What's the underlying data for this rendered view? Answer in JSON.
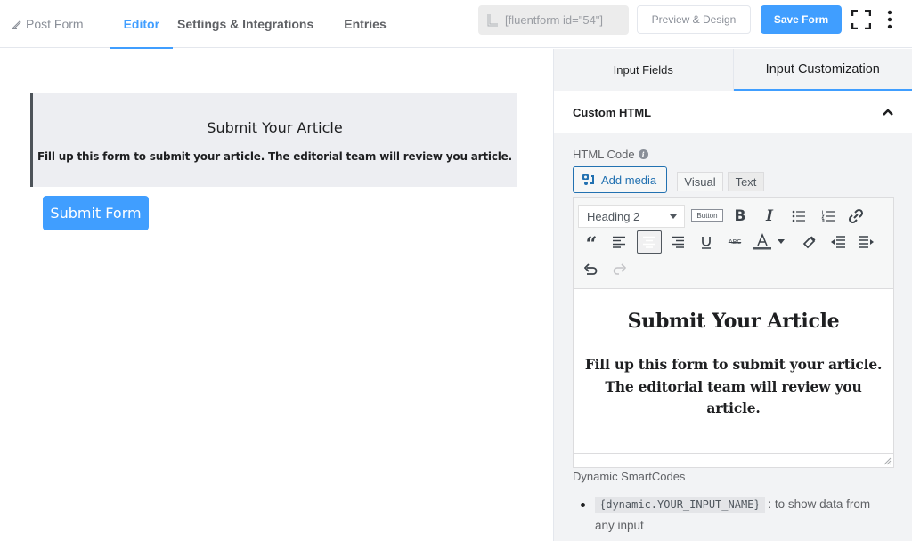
{
  "topbar": {
    "nav": [
      {
        "label": "Post Form",
        "icon": "pen-icon"
      },
      {
        "label": "Editor",
        "active": true
      },
      {
        "label": "Settings & Integrations"
      },
      {
        "label": "Entries"
      }
    ],
    "shortcode": "[fluentform id=\"54\"]",
    "preview_label": "Preview & Design",
    "save_label": "Save Form",
    "accent_color": "#409eff"
  },
  "canvas": {
    "html_block": {
      "title": "Submit Your Article",
      "text": "Fill up this form to submit your article. The editorial team will review you article."
    },
    "submit_label": "Submit Form"
  },
  "panel": {
    "tabs": [
      {
        "label": "Input Fields"
      },
      {
        "label": "Input Customization",
        "active": true
      }
    ],
    "section_title": "Custom HTML",
    "field_label": "HTML Code",
    "add_media_label": "Add media",
    "mode_tabs": [
      {
        "label": "Visual",
        "active": true
      },
      {
        "label": "Text"
      }
    ],
    "toolbar": {
      "format_value": "Heading 2",
      "button_label": "Button",
      "buttons": [
        "bold",
        "italic",
        "bullet-list",
        "numbered-list",
        "link",
        "blockquote",
        "align-left",
        "align-center",
        "align-right",
        "underline",
        "strikethrough",
        "text-color",
        "clear-formatting",
        "outdent",
        "indent",
        "undo",
        "redo"
      ]
    },
    "content": {
      "heading": "Submit Your Article",
      "paragraph": "Fill up this form to submit your article. The editorial team will review you article."
    },
    "smartcodes_label": "Dynamic SmartCodes",
    "smartcodes": [
      {
        "code": "{dynamic.YOUR_INPUT_NAME}",
        "desc": " : to show data from any input"
      }
    ]
  }
}
